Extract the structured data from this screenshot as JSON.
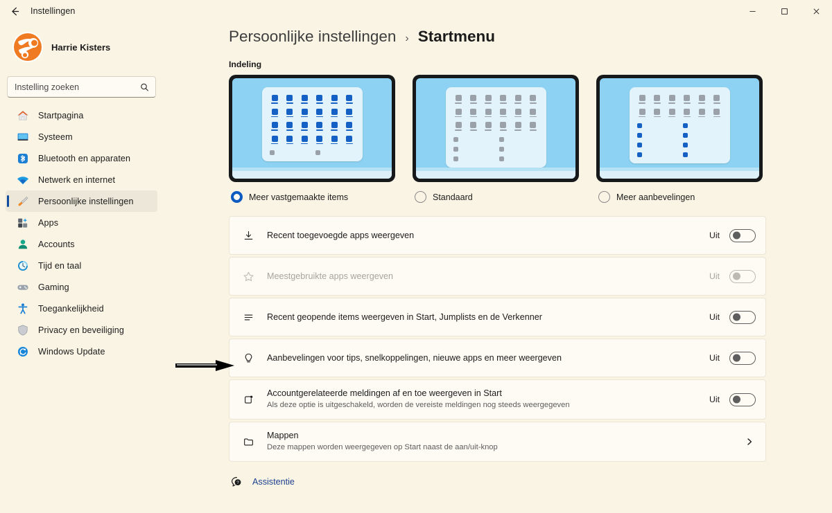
{
  "window": {
    "title": "Instellingen",
    "back_icon": "back-arrow-icon",
    "minimize_label": "—",
    "maximize_label": "□",
    "close_label": "×"
  },
  "sidebar": {
    "account_name": "Harrie Kisters",
    "search": {
      "placeholder": "Instelling zoeken",
      "value": "",
      "icon": "search-icon"
    },
    "items": [
      {
        "label": "Startpagina",
        "icon": "home-icon",
        "selected": false
      },
      {
        "label": "Systeem",
        "icon": "monitor-icon",
        "selected": false
      },
      {
        "label": "Bluetooth en apparaten",
        "icon": "bluetooth-icon",
        "selected": false
      },
      {
        "label": "Netwerk en internet",
        "icon": "wifi-icon",
        "selected": false
      },
      {
        "label": "Persoonlijke instellingen",
        "icon": "paintbrush-icon",
        "selected": true
      },
      {
        "label": "Apps",
        "icon": "apps-icon",
        "selected": false
      },
      {
        "label": "Accounts",
        "icon": "person-icon",
        "selected": false
      },
      {
        "label": "Tijd en taal",
        "icon": "clock-icon",
        "selected": false
      },
      {
        "label": "Gaming",
        "icon": "gamepad-icon",
        "selected": false
      },
      {
        "label": "Toegankelijkheid",
        "icon": "accessibility-icon",
        "selected": false
      },
      {
        "label": "Privacy en beveiliging",
        "icon": "shield-icon",
        "selected": false
      },
      {
        "label": "Windows Update",
        "icon": "update-icon",
        "selected": false
      }
    ]
  },
  "main": {
    "breadcrumb": {
      "parent": "Persoonlijke instellingen",
      "separator": "›",
      "current": "Startmenu"
    },
    "section_label": "Indeling",
    "layout_options": [
      {
        "label": "Meer vastgemaakte items",
        "selected": true,
        "icon_rows": 4,
        "icon_color": "blue",
        "rec_rows": 1,
        "rec_color": "gray"
      },
      {
        "label": "Standaard",
        "selected": false,
        "icon_rows": 3,
        "icon_color": "gray",
        "rec_rows": 3,
        "rec_color": "gray"
      },
      {
        "label": "Meer aanbevelingen",
        "selected": false,
        "icon_rows": 2,
        "icon_color": "gray",
        "rec_rows": 4,
        "rec_color": "blue"
      }
    ],
    "settings_rows": [
      {
        "icon": "download-icon",
        "title": "Recent toegevoegde apps weergeven",
        "desc": "",
        "control": "toggle",
        "state": "Uit",
        "disabled": false
      },
      {
        "icon": "star-icon",
        "title": "Meestgebruikte apps weergeven",
        "desc": "",
        "control": "toggle",
        "state": "Uit",
        "disabled": true
      },
      {
        "icon": "list-icon",
        "title": "Recent geopende items weergeven in Start, Jumplists en de Verkenner",
        "desc": "",
        "control": "toggle",
        "state": "Uit",
        "disabled": false
      },
      {
        "icon": "lightbulb-icon",
        "title": "Aanbevelingen voor tips, snelkoppelingen, nieuwe apps en meer weergeven",
        "desc": "",
        "control": "toggle",
        "state": "Uit",
        "disabled": false
      },
      {
        "icon": "notification-icon",
        "title": "Accountgerelateerde meldingen af en toe weergeven in Start",
        "desc": "Als deze optie is uitgeschakeld, worden de vereiste meldingen nog steeds weergegeven",
        "control": "toggle",
        "state": "Uit",
        "disabled": false
      },
      {
        "icon": "folder-icon",
        "title": "Mappen",
        "desc": "Deze mappen worden weergegeven op Start naast de aan/uit-knop",
        "control": "chevron",
        "state": "",
        "disabled": false
      }
    ],
    "help": {
      "icon": "help-icon",
      "label": "Assistentie"
    }
  },
  "annotation": {
    "arrow": "pointer-arrow",
    "points_at": "Aanbevelingen voor tips, snelkoppelingen, nieuwe apps en meer weergeven"
  },
  "colors": {
    "background": "#faf4e4",
    "card": "#fdfbf4",
    "accent": "#0d5ac1",
    "link": "#1b3f8f",
    "selected_nav": "#ece7d8"
  }
}
